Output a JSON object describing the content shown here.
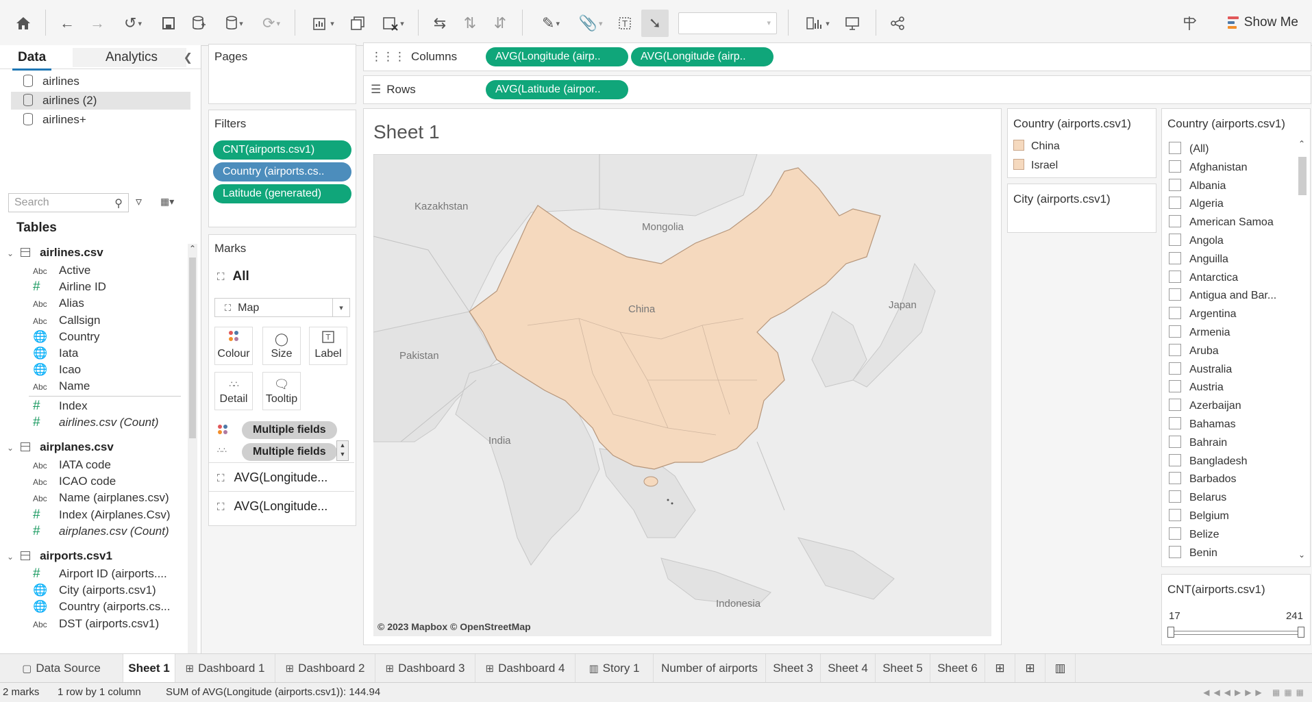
{
  "toolbar": {
    "show_me_label": "Show Me",
    "icons": [
      "home-icon",
      "undo-icon",
      "redo-icon",
      "replay-icon",
      "save-icon",
      "new-datasource-icon",
      "pause-updates-icon",
      "refresh-icon",
      "new-worksheet-icon",
      "duplicate-sheet-icon",
      "clear-sheet-icon",
      "swap-axes-icon",
      "sort-ascending-icon",
      "sort-descending-icon",
      "highlight-icon",
      "group-icon",
      "show-labels-icon",
      "fix-axes-icon",
      "presentation-icon",
      "share-icon"
    ],
    "bars_colors": [
      "#e15759",
      "#4e79a7",
      "#f28e2b"
    ]
  },
  "datapane": {
    "tab_data": "Data",
    "tab_analytics": "Analytics",
    "datasources": [
      "airlines",
      "airlines (2)",
      "airlines+"
    ],
    "search_placeholder": "Search",
    "tables_label": "Tables",
    "tables": [
      {
        "name": "airlines.csv",
        "fields": [
          {
            "type": "Abc",
            "name": "Active"
          },
          {
            "type": "#",
            "name": "Airline ID"
          },
          {
            "type": "Abc",
            "name": "Alias"
          },
          {
            "type": "Abc",
            "name": "Callsign"
          },
          {
            "type": "globe",
            "name": "Country"
          },
          {
            "type": "globe",
            "name": "Iata"
          },
          {
            "type": "globe",
            "name": "Icao"
          },
          {
            "type": "Abc",
            "name": "Name"
          },
          {
            "type": "#",
            "name": "Index"
          },
          {
            "type": "#",
            "name": "airlines.csv (Count)"
          }
        ]
      },
      {
        "name": "airplanes.csv",
        "fields": [
          {
            "type": "Abc",
            "name": "IATA code"
          },
          {
            "type": "Abc",
            "name": "ICAO code"
          },
          {
            "type": "Abc",
            "name": "Name (airplanes.csv)"
          },
          {
            "type": "#",
            "name": "Index (Airplanes.Csv)"
          },
          {
            "type": "#",
            "name": "airplanes.csv (Count)"
          }
        ]
      },
      {
        "name": "airports.csv1",
        "fields": [
          {
            "type": "#",
            "name": "Airport ID (airports...."
          },
          {
            "type": "globe",
            "name": "City (airports.csv1)"
          },
          {
            "type": "globe",
            "name": "Country (airports.cs..."
          },
          {
            "type": "Abc",
            "name": "DST (airports.csv1)"
          }
        ]
      }
    ]
  },
  "pages": {
    "title": "Pages"
  },
  "filters": {
    "title": "Filters",
    "pills": [
      "CNT(airports.csv1)",
      "Country (airports.cs..",
      "Latitude (generated)"
    ]
  },
  "marks": {
    "title": "Marks",
    "all_label": "All",
    "type_label": "Map",
    "buttons": [
      "Colour",
      "Size",
      "Label",
      "Detail",
      "Tooltip"
    ],
    "shelf_pills": [
      "Multiple fields",
      "Multiple fields"
    ],
    "layers": [
      "AVG(Longitude...",
      "AVG(Longitude..."
    ]
  },
  "columns": {
    "label": "Columns",
    "pills": [
      "AVG(Longitude (airp..",
      "AVG(Longitude (airp.."
    ]
  },
  "rows": {
    "label": "Rows",
    "pills": [
      "AVG(Latitude (airpor.."
    ]
  },
  "view": {
    "title": "Sheet 1",
    "labels": {
      "kazakhstan": "Kazakhstan",
      "mongolia": "Mongolia",
      "china": "China",
      "japan": "Japan",
      "pakistan": "Pakistan",
      "india": "India",
      "indonesia": "Indonesia"
    },
    "attribution": "© 2023 Mapbox © OpenStreetMap",
    "highlight_color": "#f5d9be"
  },
  "legend_country": {
    "title": "Country (airports.csv1)",
    "items": [
      "China",
      "Israel"
    ]
  },
  "legend_city": {
    "title": "City (airports.csv1)"
  },
  "filter_list": {
    "title": "Country (airports.csv1)",
    "items": [
      "(All)",
      "Afghanistan",
      "Albania",
      "Algeria",
      "American Samoa",
      "Angola",
      "Anguilla",
      "Antarctica",
      "Antigua and Bar...",
      "Argentina",
      "Armenia",
      "Aruba",
      "Australia",
      "Austria",
      "Azerbaijan",
      "Bahamas",
      "Bahrain",
      "Bangladesh",
      "Barbados",
      "Belarus",
      "Belgium",
      "Belize",
      "Benin"
    ]
  },
  "range": {
    "title": "CNT(airports.csv1)",
    "min": "17",
    "max": "241"
  },
  "sheet_tabs": [
    {
      "label": "Data Source",
      "icon": "datasource-icon",
      "active": false
    },
    {
      "label": "Sheet 1",
      "icon": "",
      "active": true
    },
    {
      "label": "Dashboard 1",
      "icon": "dashboard-icon",
      "active": false
    },
    {
      "label": "Dashboard 2",
      "icon": "dashboard-icon",
      "active": false
    },
    {
      "label": "Dashboard 3",
      "icon": "dashboard-icon",
      "active": false
    },
    {
      "label": "Dashboard 4",
      "icon": "dashboard-icon",
      "active": false
    },
    {
      "label": "Story 1",
      "icon": "story-icon",
      "active": false
    },
    {
      "label": "Number of airports",
      "icon": "",
      "active": false
    },
    {
      "label": "Sheet 3",
      "icon": "",
      "active": false
    },
    {
      "label": "Sheet 4",
      "icon": "",
      "active": false
    },
    {
      "label": "Sheet 5",
      "icon": "",
      "active": false
    },
    {
      "label": "Sheet 6",
      "icon": "",
      "active": false
    }
  ],
  "status": {
    "marks": "2 marks",
    "dims": "1 row  by  1 column",
    "sum": "SUM of AVG(Longitude (airports.csv1)): 144.94"
  }
}
